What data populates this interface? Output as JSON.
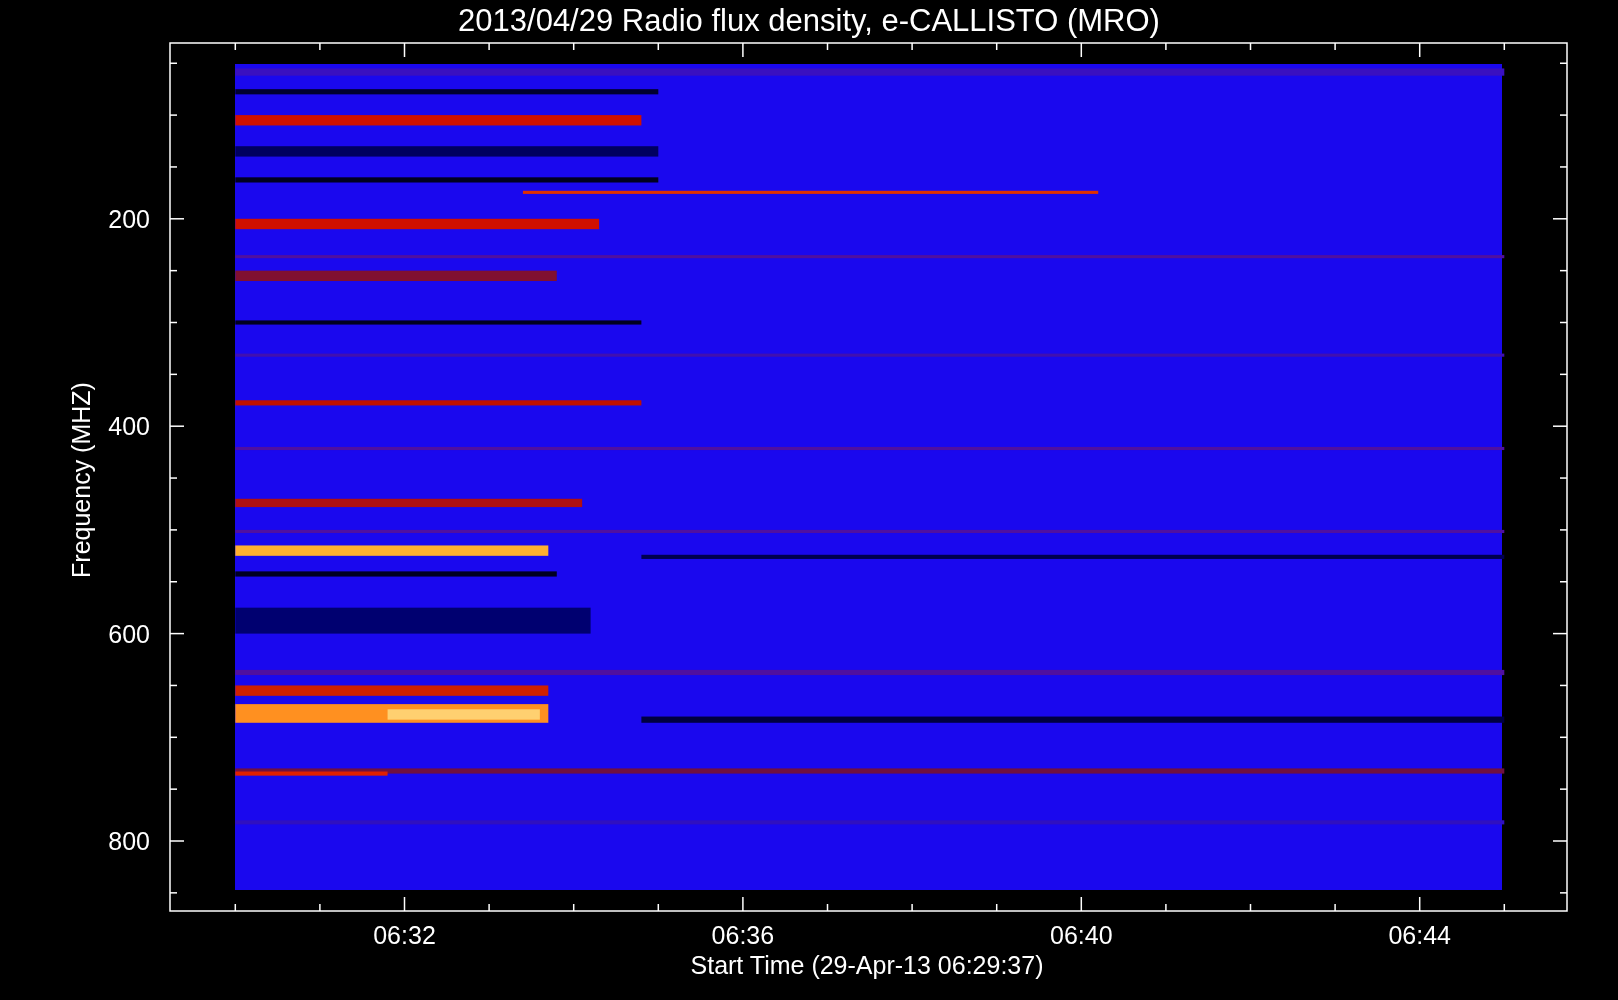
{
  "title": "2013/04/29  Radio flux density, e-CALLISTO (MRO)",
  "y_axis": {
    "label": "Frequency (MHZ)",
    "ticks": [
      "200",
      "400",
      "600",
      "800"
    ]
  },
  "x_axis": {
    "label": "Start Time (29-Apr-13 06:29:37)",
    "ticks": [
      "06:32",
      "06:36",
      "06:40",
      "06:44"
    ]
  }
}
